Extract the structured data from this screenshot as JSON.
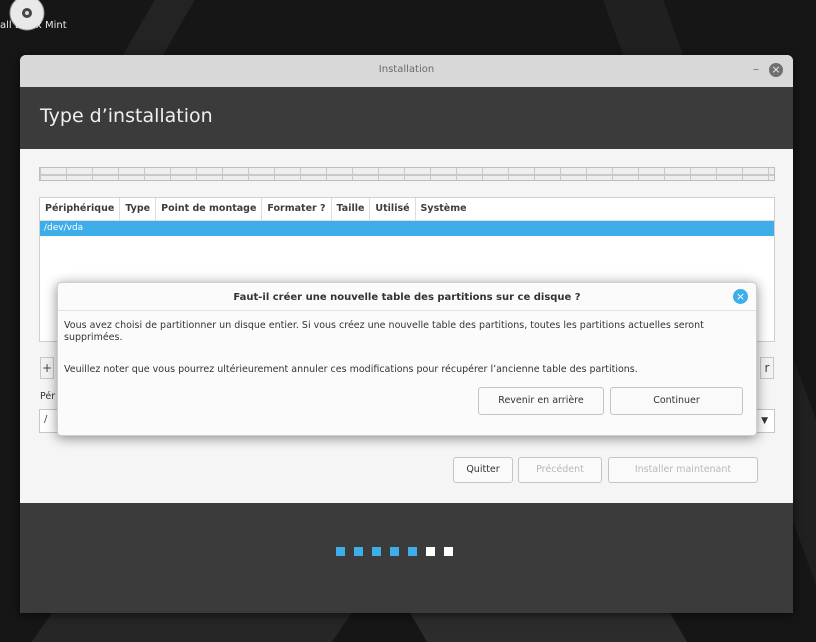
{
  "desktop": {
    "icon_label": "all Linux Mint",
    "icon": "disc-icon"
  },
  "window": {
    "title": "Installation",
    "minimize": "–",
    "close": "×"
  },
  "header": {
    "title": "Type d’installation"
  },
  "table": {
    "columns": [
      "Périphérique",
      "Type",
      "Point de montage",
      "Formater ?",
      "Taille",
      "Utilisé",
      "Système"
    ],
    "rows": [
      {
        "device": "/dev/vda"
      }
    ]
  },
  "device_section": {
    "label": "Pér",
    "selected": "/"
  },
  "buttons": {
    "quit": "Quitter",
    "previous": "Précédent",
    "install_now": "Installer maintenant",
    "add": "+",
    "change": "r"
  },
  "dialog": {
    "title": "Faut-il créer une nouvelle table des partitions sur ce disque ?",
    "message1": "Vous avez choisi de partitionner un disque entier. Si vous créez une nouvelle table des partitions, toutes les partitions actuelles seront supprimées.",
    "message2": "Veuillez noter que vous pourrez ultérieurement annuler ces modifications pour récupérer l’ancienne table des partitions.",
    "back_button": "Revenir en arrière",
    "continue_button": "Continuer"
  },
  "progress": {
    "total_steps": 7,
    "completed_steps": 5
  },
  "colors": {
    "accent": "#3daee9",
    "header_bg": "#3b3b3b"
  }
}
